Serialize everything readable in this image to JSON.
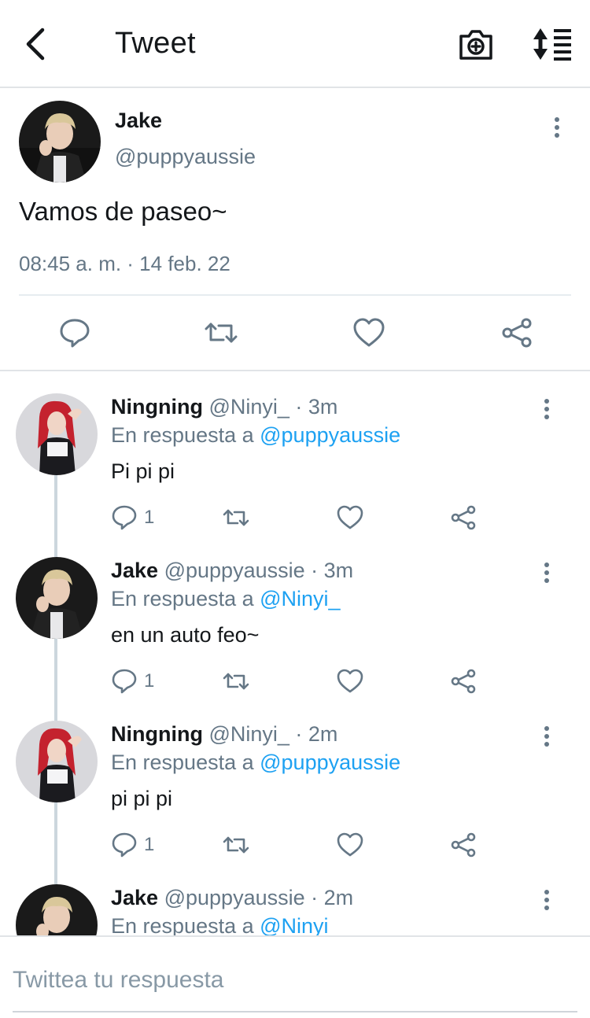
{
  "header": {
    "title": "Tweet",
    "back_icon": "chevron-left-icon",
    "camera_icon": "camera-add-icon",
    "sort_icon": "sort-list-icon"
  },
  "main_tweet": {
    "name": "Jake",
    "handle": "@puppyaussie",
    "text": "Vamos de paseo~",
    "timestamp": "08:45 a. m. · 14 feb. 22",
    "actions": [
      "reply-icon",
      "retweet-icon",
      "like-icon",
      "share-icon"
    ]
  },
  "replies": [
    {
      "name": "Ningning",
      "meta": "@Ninyi_ · 3m",
      "reply_prefix": "En respuesta a ",
      "reply_to": "@puppyaussie",
      "text": "Pi pi pi",
      "reply_count": "1",
      "avatar": "red-hair"
    },
    {
      "name": "Jake",
      "meta": "@puppyaussie · 3m",
      "reply_prefix": "En respuesta a ",
      "reply_to": "@Ninyi_",
      "text": "en un auto feo~",
      "reply_count": "1",
      "avatar": "blond"
    },
    {
      "name": "Ningning",
      "meta": "@Ninyi_ · 2m",
      "reply_prefix": "En respuesta a ",
      "reply_to": "@puppyaussie",
      "text": "pi pi pi",
      "reply_count": "1",
      "avatar": "red-hair"
    },
    {
      "name": "Jake",
      "meta": "@puppyaussie · 2m",
      "reply_prefix": "En respuesta a ",
      "reply_to": "@Ninyi_",
      "text": "",
      "reply_count": "",
      "avatar": "blond"
    }
  ],
  "composer": {
    "placeholder": "Twittea tu respuesta"
  },
  "colors": {
    "link": "#1da1f2",
    "secondary_text": "#657786",
    "icon": "#657786",
    "divider": "#e1e4e7"
  }
}
